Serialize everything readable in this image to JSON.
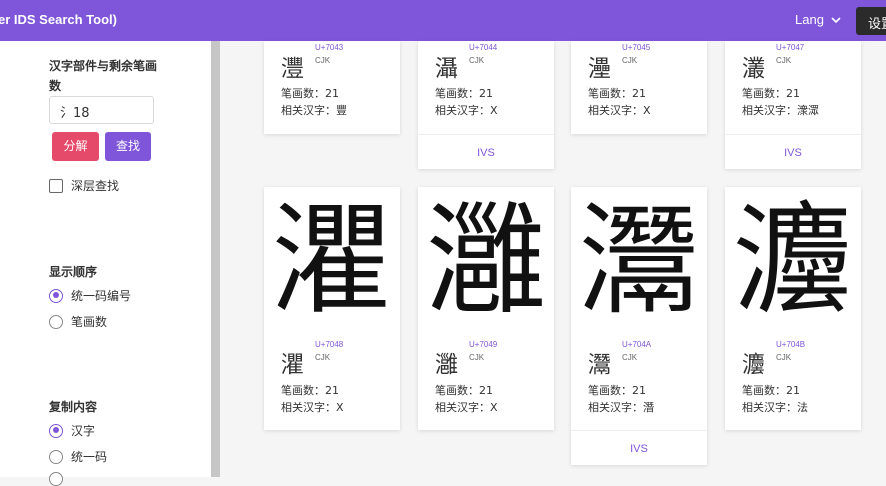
{
  "header": {
    "title": "er IDS Search Tool)",
    "lang_label": "Lang",
    "settings_label": "设置"
  },
  "sidebar": {
    "component_section_title_line1": "汉字部件与剩余笔画",
    "component_section_title_line2": "数",
    "component_input_value": "氵18",
    "decompose_button": "分解",
    "search_button": "查找",
    "deep_search_label": "深层查找",
    "display_order_title": "显示顺序",
    "order_options": [
      "统一码编号",
      "笔画数"
    ],
    "copy_content_title": "复制内容",
    "copy_options": [
      "汉字",
      "统一码"
    ]
  },
  "cards_row1": [
    {
      "char": "灃",
      "code": "U+7043",
      "type": "CJK",
      "strokes": "笔画数：21",
      "related": "相关汉字：豐",
      "ivs": ""
    },
    {
      "char": "灄",
      "code": "U+7044",
      "type": "CJK",
      "strokes": "笔画数：21",
      "related": "相关汉字：X",
      "ivs": "IVS"
    },
    {
      "char": "灅",
      "code": "U+7045",
      "type": "CJK",
      "strokes": "笔画数：21",
      "related": "相关汉字：X",
      "ivs": ""
    },
    {
      "char": "灇",
      "code": "U+7047",
      "type": "CJK",
      "strokes": "笔画数：21",
      "related": "相关汉字：潨潀",
      "ivs": "IVS"
    }
  ],
  "cards_row2": [
    {
      "char": "灈",
      "code": "U+7048",
      "type": "CJK",
      "strokes": "笔画数：21",
      "related": "相关汉字：X",
      "ivs": ""
    },
    {
      "char": "灉",
      "code": "U+7049",
      "type": "CJK",
      "strokes": "笔画数：21",
      "related": "相关汉字：X",
      "ivs": ""
    },
    {
      "char": "灊",
      "code": "U+704A",
      "type": "CJK",
      "strokes": "笔画数：21",
      "related": "相关汉字：潛",
      "ivs": "IVS"
    },
    {
      "char": "灋",
      "code": "U+704B",
      "type": "CJK",
      "strokes": "笔画数：21",
      "related": "相关汉字：法",
      "ivs": ""
    }
  ],
  "colors": {
    "header_bg": "#7f56d9",
    "accent": "#7f56d9",
    "decompose_button": "#e54a6a"
  }
}
